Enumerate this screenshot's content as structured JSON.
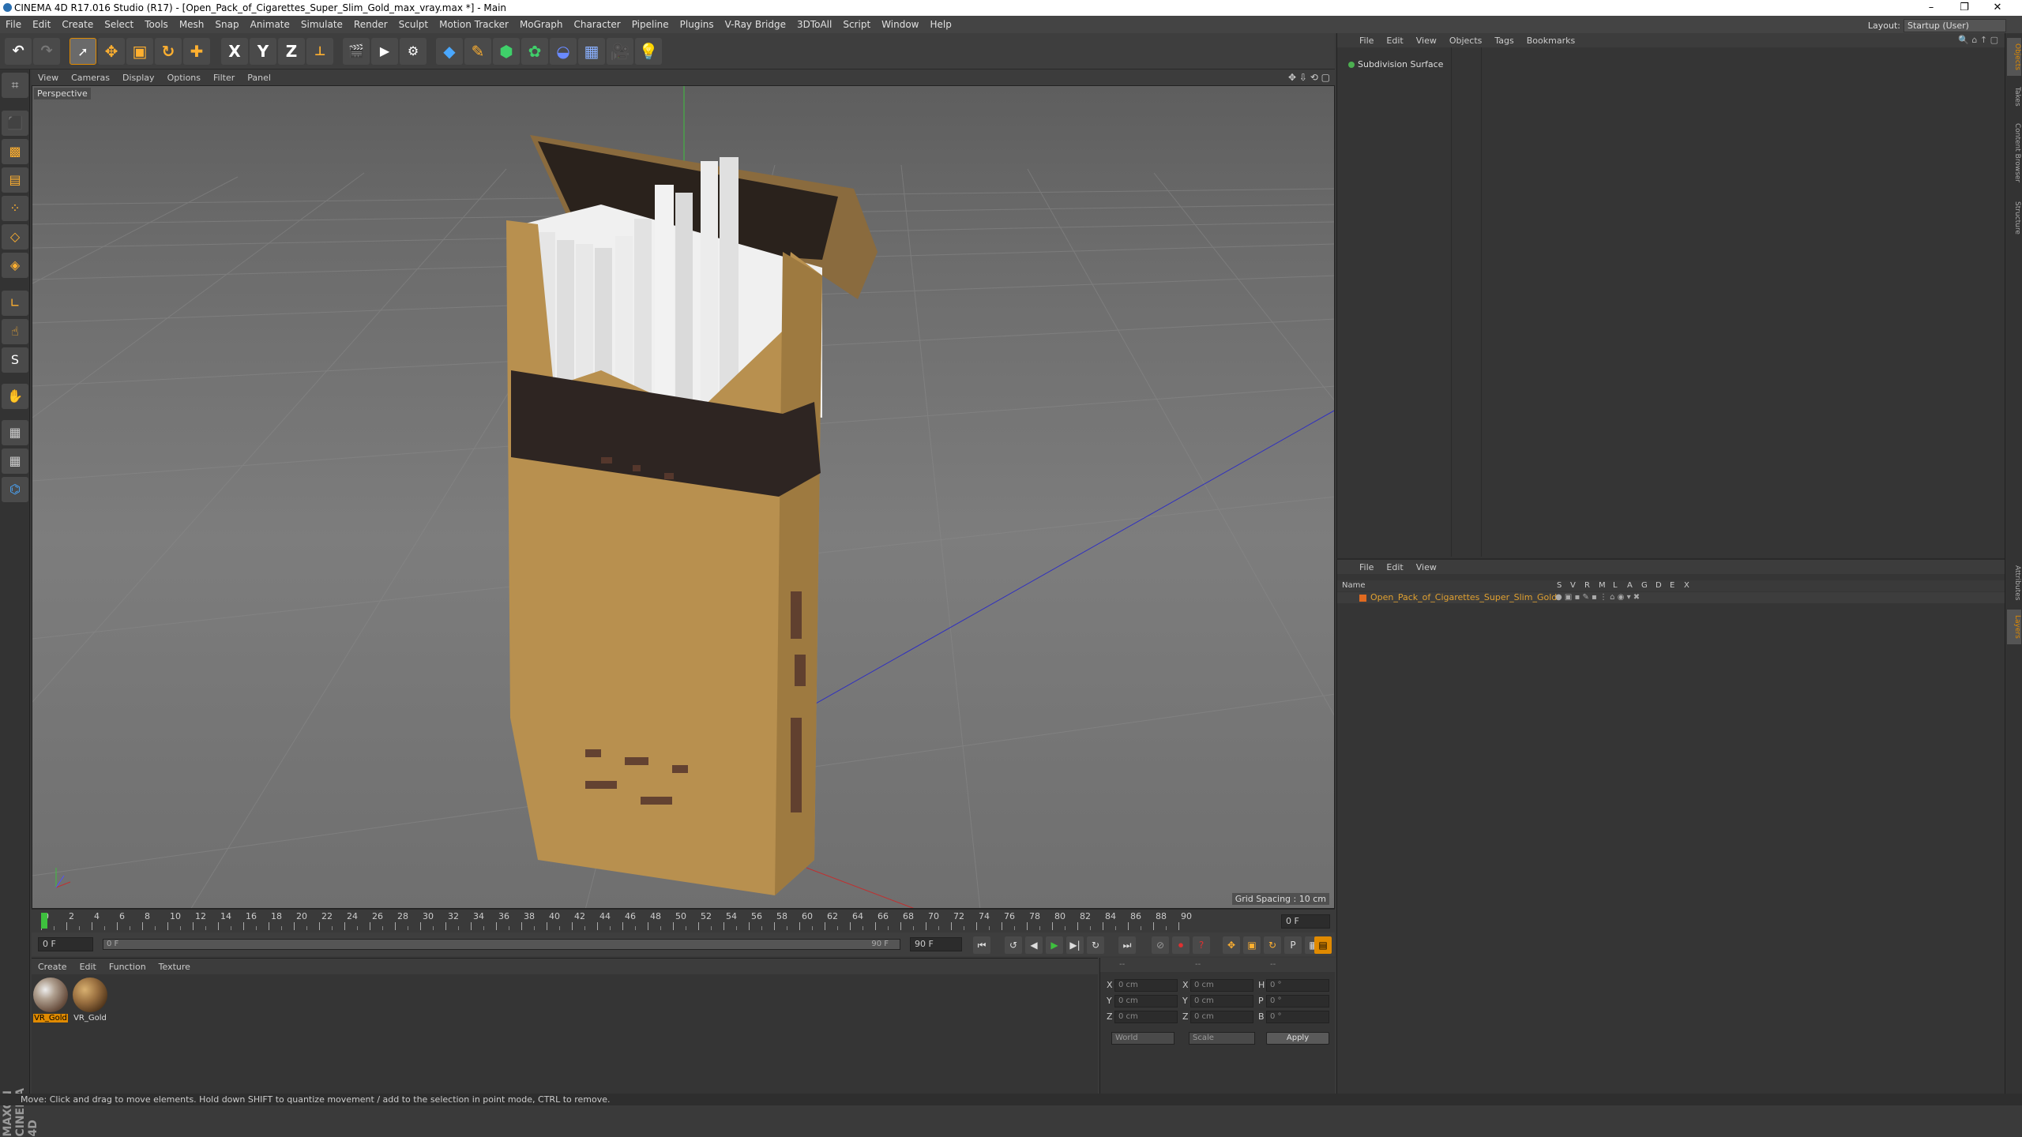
{
  "window": {
    "title": "CINEMA 4D R17.016 Studio (R17) - [Open_Pack_of_Cigarettes_Super_Slim_Gold_max_vray.max *] - Main",
    "controls": [
      "–",
      "❐",
      "✕"
    ]
  },
  "menubar": {
    "items": [
      "File",
      "Edit",
      "Create",
      "Select",
      "Tools",
      "Mesh",
      "Snap",
      "Animate",
      "Simulate",
      "Render",
      "Sculpt",
      "Motion Tracker",
      "MoGraph",
      "Character",
      "Pipeline",
      "Plugins",
      "V-Ray Bridge",
      "3DToAll",
      "Script",
      "Window",
      "Help"
    ],
    "layout_label": "Layout:",
    "layout_value": "Startup (User)"
  },
  "toolbar": {
    "x_axis": "X",
    "y_axis": "Y",
    "z_axis": "Z"
  },
  "viewport": {
    "menu": [
      "View",
      "Cameras",
      "Display",
      "Options",
      "Filter",
      "Panel"
    ],
    "label": "Perspective",
    "grid_spacing": "Grid Spacing : 10 cm"
  },
  "timeline": {
    "ticks": [
      "0",
      "2",
      "4",
      "6",
      "8",
      "10",
      "12",
      "14",
      "16",
      "18",
      "20",
      "22",
      "24",
      "26",
      "28",
      "30",
      "32",
      "34",
      "36",
      "38",
      "40",
      "42",
      "44",
      "46",
      "48",
      "50",
      "52",
      "54",
      "56",
      "58",
      "60",
      "62",
      "64",
      "66",
      "68",
      "70",
      "72",
      "74",
      "76",
      "78",
      "80",
      "82",
      "84",
      "86",
      "88",
      "90"
    ],
    "current_frame": "0 F",
    "start_field": "0 F",
    "slider_start": "0 F",
    "slider_end": "90 F",
    "end_field": "90 F"
  },
  "material_manager": {
    "menu": [
      "Create",
      "Edit",
      "Function",
      "Texture"
    ],
    "materials": [
      {
        "label": "VR_Gold",
        "selected": true
      },
      {
        "label": "VR_Gold",
        "selected": false
      }
    ]
  },
  "coordinates": {
    "header_left": "--",
    "header_mid": "--",
    "header_right": "--",
    "rows": [
      {
        "a": "X",
        "av": "0 cm",
        "b": "X",
        "bv": "0 cm",
        "c": "H",
        "cv": "0 °"
      },
      {
        "a": "Y",
        "av": "0 cm",
        "b": "Y",
        "bv": "0 cm",
        "c": "P",
        "cv": "0 °"
      },
      {
        "a": "Z",
        "av": "0 cm",
        "b": "Z",
        "bv": "0 cm",
        "c": "B",
        "cv": "0 °"
      }
    ],
    "mode1": "World",
    "mode2": "Scale",
    "apply": "Apply"
  },
  "object_manager": {
    "menu": [
      "File",
      "Edit",
      "View",
      "Objects",
      "Tags",
      "Bookmarks"
    ],
    "objects": [
      {
        "name": "Subdivision Surface"
      }
    ]
  },
  "layer_manager": {
    "menu": [
      "File",
      "Edit",
      "View"
    ],
    "columns": [
      "Name",
      "S",
      "V",
      "R",
      "M",
      "L",
      "A",
      "G",
      "D",
      "E",
      "X"
    ],
    "layers": [
      {
        "name": "Open_Pack_of_Cigarettes_Super_Slim_Gold",
        "color": "#e06a20"
      }
    ]
  },
  "right_tabs": [
    "Objects",
    "Takes",
    "Content Browser",
    "Structure",
    "Attributes",
    "Layers"
  ],
  "statusbar": {
    "text": "Move: Click and drag to move elements. Hold down SHIFT to quantize movement / add to the selection in point mode, CTRL to remove."
  },
  "colors": {
    "accent": "#e08a00",
    "layer_text": "#e0a030",
    "pack": "#b58a4a",
    "band": "#3a2a26"
  }
}
